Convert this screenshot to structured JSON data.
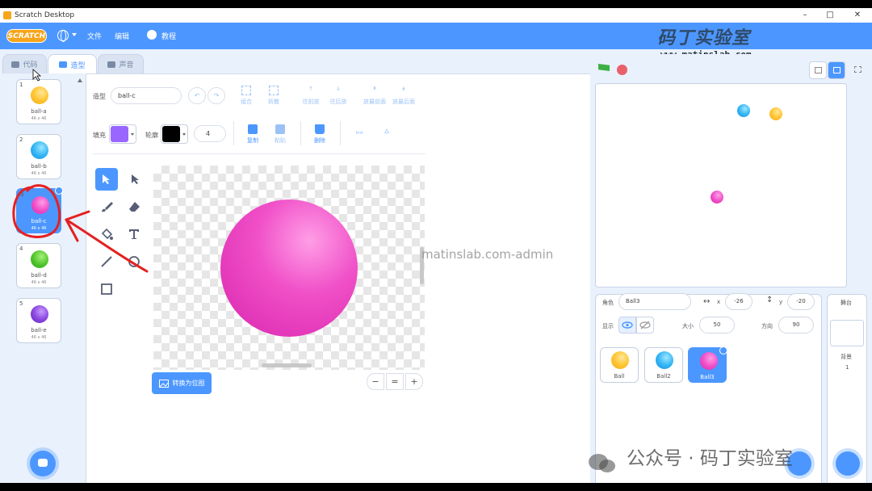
{
  "window": {
    "title": "Scratch Desktop"
  },
  "menu": {
    "logo": "SCRATCH",
    "file": "文件",
    "edit": "编辑",
    "tutorials": "教程"
  },
  "brand": {
    "name": "码丁实验室",
    "url": "www.matinslab.com"
  },
  "tabs": {
    "code": "代码",
    "costumes": "造型",
    "sounds": "声音"
  },
  "costumes": [
    {
      "num": "1",
      "name": "ball-a",
      "size": "46 x 46",
      "color": "#ffc531"
    },
    {
      "num": "2",
      "name": "ball-b",
      "size": "46 x 46",
      "color": "#34b6f5"
    },
    {
      "num": "3",
      "name": "ball-c",
      "size": "46 x 46",
      "color": "#f050c8"
    },
    {
      "num": "4",
      "name": "ball-d",
      "size": "46 x 46",
      "color": "#52c72e"
    },
    {
      "num": "5",
      "name": "ball-e",
      "size": "46 x 46",
      "color": "#8c47e0"
    }
  ],
  "editor": {
    "costume_label": "造型",
    "costume_name": "ball-c",
    "group": "组合",
    "ungroup": "拆散",
    "forward": "往前放",
    "backward": "往后放",
    "front": "放最前面",
    "back": "放最后面",
    "fill_label": "填充",
    "outline_label": "轮廓",
    "outline_width": "4",
    "copy": "复制",
    "paste": "粘贴",
    "delete": "删除",
    "fill_color": "#9966ff",
    "outline_color": "#000000",
    "convert": "转换为位图",
    "zoom_equal": "="
  },
  "watermark": "matinslab.com-admin",
  "sprite": {
    "sprite_label": "角色",
    "name": "Ball3",
    "x_label": "x",
    "x": "-26",
    "y_label": "y",
    "y": "-20",
    "show_label": "显示",
    "size_label": "大小",
    "size": "50",
    "direction_label": "方向",
    "direction": "90"
  },
  "sprites": [
    {
      "name": "Ball",
      "color": "#ffc531"
    },
    {
      "name": "Ball2",
      "color": "#34b6f5"
    },
    {
      "name": "Ball3",
      "color": "#f050c8"
    }
  ],
  "stage_pane": {
    "title": "舞台",
    "backdrops_label": "背景",
    "backdrops_count": "1"
  },
  "wechat": "公众号 · 码丁实验室"
}
